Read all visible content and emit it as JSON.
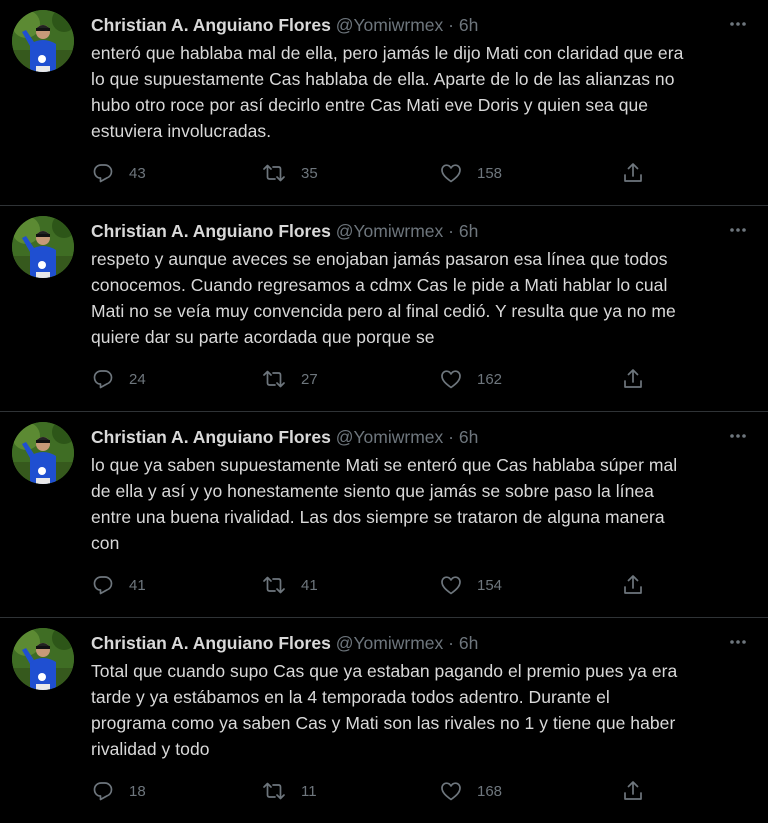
{
  "author": {
    "name": "Christian A. Anguiano Flores",
    "handle": "@Yomiwrmex",
    "separator": "·"
  },
  "colors": {
    "background": "#000000",
    "text": "#d9d9d9",
    "muted": "#6e767d",
    "divider": "#2f3336"
  },
  "icons": {
    "reply": "reply-icon",
    "retweet": "retweet-icon",
    "like": "heart-icon",
    "share": "share-icon",
    "more": "more-icon"
  },
  "tweets": [
    {
      "time": "6h",
      "lines": [
        "enteró que hablaba mal de ella, pero jamás le dijo Mati con claridad que era",
        "lo que supuestamente Cas hablaba de ella. Aparte de lo de las alianzas no",
        "hubo otro roce por así decirlo entre Cas Mati eve Doris y quien sea que",
        "estuviera involucradas."
      ],
      "replies": "43",
      "retweets": "35",
      "likes": "158"
    },
    {
      "time": "6h",
      "lines": [
        "respeto y aunque aveces se enojaban jamás pasaron esa línea que todos",
        "conocemos. Cuando regresamos a cdmx Cas le pide a Mati hablar lo cual",
        "Mati no se veía muy convencida pero al final cedió. Y resulta que ya no me",
        "quiere dar su parte acordada que porque se"
      ],
      "replies": "24",
      "retweets": "27",
      "likes": "162"
    },
    {
      "time": "6h",
      "lines": [
        "lo que ya saben supuestamente Mati se enteró que Cas hablaba súper mal",
        "de ella y así y yo honestamente siento que jamás se sobre paso la línea",
        "entre una buena rivalidad. Las dos siempre se trataron de alguna manera",
        "con"
      ],
      "replies": "41",
      "retweets": "41",
      "likes": "154"
    },
    {
      "time": "6h",
      "lines": [
        "Total que cuando supo Cas que ya estaban pagando el premio pues ya era",
        "tarde y ya estábamos en la 4 temporada todos adentro. Durante el",
        "programa como ya saben Cas y Mati son las rivales no 1 y tiene que haber",
        "rivalidad y todo"
      ],
      "replies": "18",
      "retweets": "11",
      "likes": "168"
    }
  ]
}
